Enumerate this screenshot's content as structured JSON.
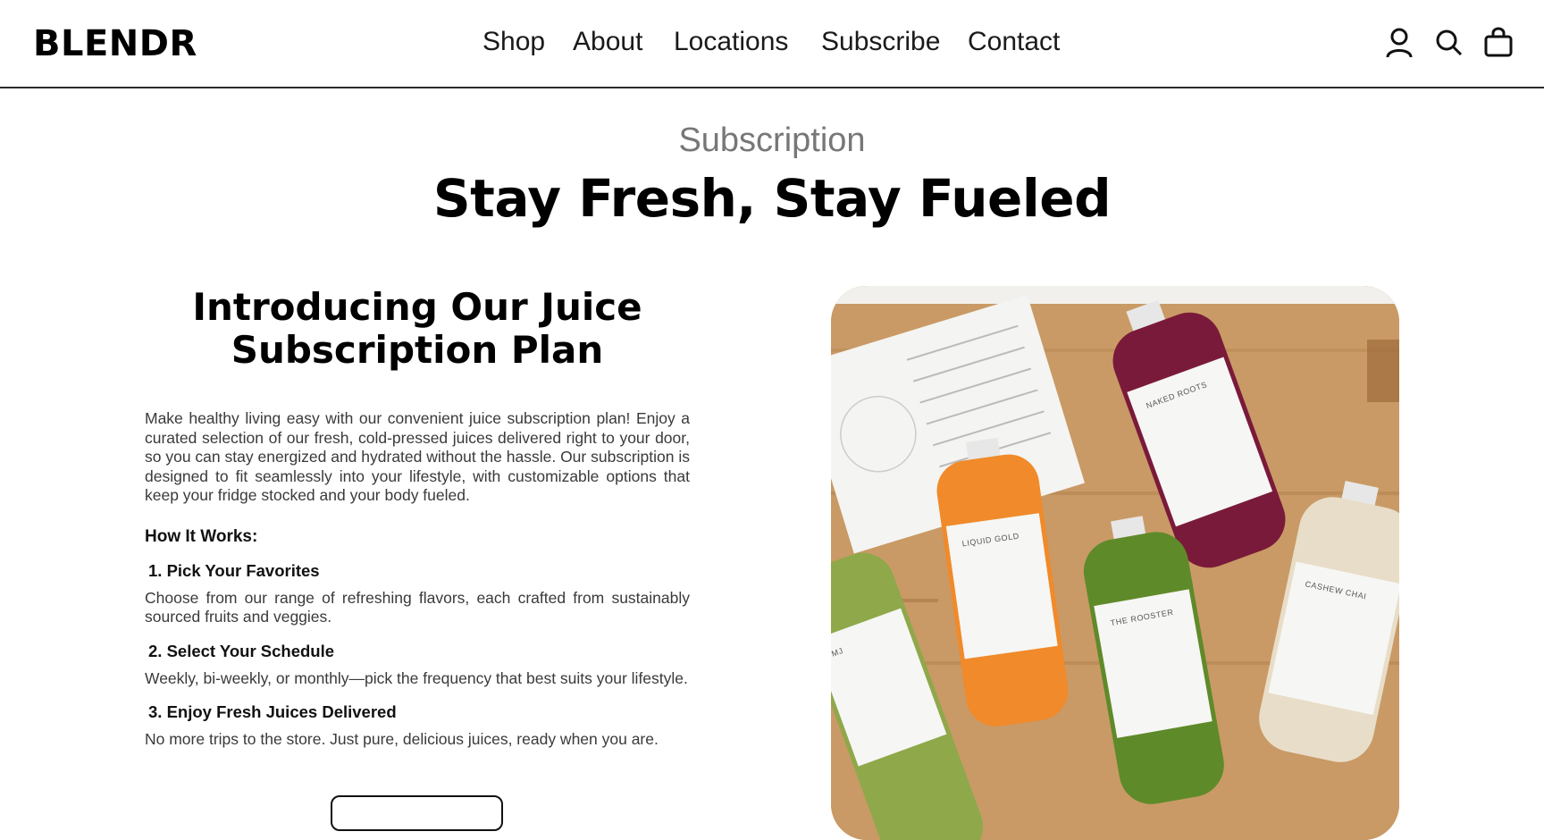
{
  "brand": {
    "logo": "BLENDR"
  },
  "nav": {
    "items": [
      {
        "label": "Shop"
      },
      {
        "label": "About"
      },
      {
        "label": "Locations"
      },
      {
        "label": "Subscribe"
      },
      {
        "label": "Contact"
      }
    ]
  },
  "header_icons": [
    "user-icon",
    "search-icon",
    "bag-icon"
  ],
  "hero": {
    "eyebrow": "Subscription",
    "headline": "Stay Fresh, Stay Fueled"
  },
  "intro": {
    "title": "Introducing Our Juice Subscription Plan",
    "body": "Make healthy living easy with our convenient juice subscription plan! Enjoy a curated selection of our fresh, cold-pressed juices delivered right to your door, so you can stay energized and hydrated without the hassle. Our subscription is designed to fit seamlessly into your lifestyle, with customizable options that keep your fridge stocked and your body fueled.",
    "how_title": "How It Works:",
    "steps": [
      {
        "title": "1. Pick Your Favorites",
        "body": "Choose from our range of refreshing flavors, each crafted from sustainably sourced fruits and veggies."
      },
      {
        "title": "2. Select Your Schedule",
        "body": "Weekly, bi-weekly, or monthly—pick the frequency that best suits your lifestyle."
      },
      {
        "title": "3. Enjoy Fresh Juices Delivered",
        "body": "No more trips to the store. Just pure, delicious juices, ready when you are."
      }
    ]
  },
  "photo": {
    "bottle_labels": [
      "MJ",
      "LIQUID GOLD",
      "THE ROOSTER",
      "NAKED ROOTS",
      "CASHEW CHAI"
    ],
    "colors": {
      "wood": "#c99a66",
      "mj": "#8fa84a",
      "liquid_gold": "#f08a2a",
      "rooster": "#5f8a2a",
      "naked_roots": "#7a1a3a",
      "cashew_chai": "#e8ddc8"
    }
  }
}
